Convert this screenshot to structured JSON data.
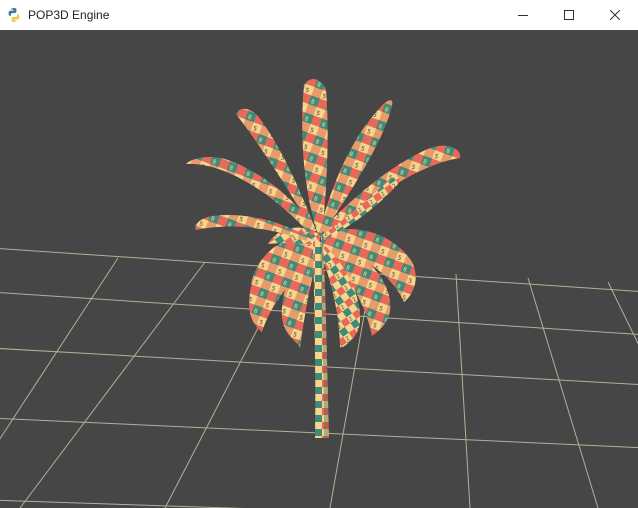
{
  "window": {
    "title": "POP3D Engine",
    "app_icon": "python-logo-icon",
    "controls": [
      "minimize-icon",
      "maximize-icon",
      "close-icon"
    ]
  },
  "scene": {
    "background_color": "#464646",
    "grid_color": "#c9c2a3",
    "palette": [
      "#e8685a",
      "#f6d58c",
      "#3f8a78",
      "#e89a6a"
    ],
    "object": "checker-textured palm tree"
  }
}
